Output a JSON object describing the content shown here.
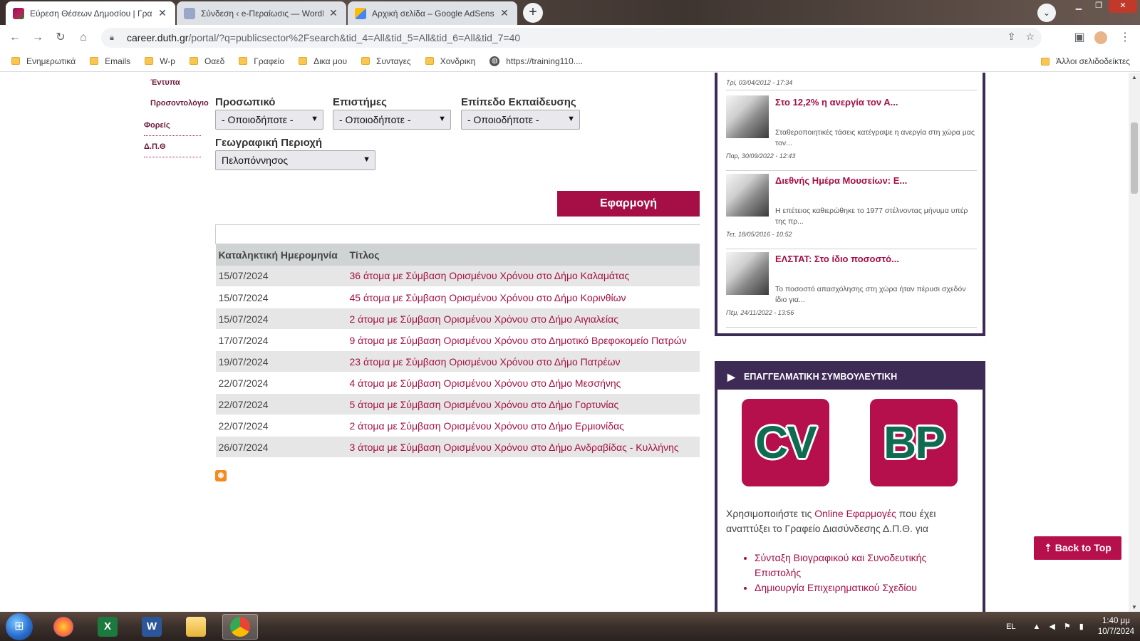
{
  "browser": {
    "tabs": [
      {
        "label": "Εύρεση Θέσεων Δημοσίου | Γραφ",
        "active": true
      },
      {
        "label": "Σύνδεση ‹ e-Περαίωσις — WordP",
        "active": false
      },
      {
        "label": "Αρχική σελίδα – Google AdSense",
        "active": false
      }
    ],
    "new_tab": "+",
    "url_host": "career.duth.gr",
    "url_path": "/portal/?q=publicsector%2Fsearch&tid_4=All&tid_5=All&tid_6=All&tid_7=40",
    "bookmarks": [
      "Ενημερωτικά",
      "Emails",
      "W-p",
      "Οαεδ",
      "Γραφείο",
      "Δικα μου",
      "Συνταγες",
      "Χονδρικη"
    ],
    "bookmark_link": "https://training110....",
    "other_bookmarks": "Άλλοι σελιδοδείκτες"
  },
  "left_nav": {
    "items": [
      "Έντυπα",
      "Προσοντολόγιο",
      "Φορείς",
      "Δ.Π.Θ"
    ]
  },
  "filters": {
    "staff_label": "Προσωπικό",
    "staff_value": "- Οποιοδήποτε -",
    "science_label": "Επιστήμες",
    "science_value": "- Οποιοδήποτε -",
    "education_label": "Επίπεδο Εκπαίδευσης",
    "education_value": "- Οποιοδήποτε -",
    "region_label": "Γεωγραφική Περιοχή",
    "region_value": "Πελοπόννησος",
    "apply_label": "Εφαρμογή"
  },
  "results": {
    "col_date": "Καταληκτική Ημερομηνία",
    "col_title": "Τίτλος",
    "rows": [
      {
        "date": "15/07/2024",
        "title": "36 άτομα με Σύμβαση Ορισμένου Χρόνου στο Δήμο Καλαμάτας"
      },
      {
        "date": "15/07/2024",
        "title": "45 άτομα με Σύμβαση Ορισμένου Χρόνου στο Δήμο Κορινθίων"
      },
      {
        "date": "15/07/2024",
        "title": "2 άτομα με Σύμβαση Ορισμένου Χρόνου στο Δήμο Αιγιαλείας"
      },
      {
        "date": "17/07/2024",
        "title": "9 άτομα με Σύμβαση Ορισμένου Χρόνου στο Δημοτικό Βρεφοκομείο Πατρών"
      },
      {
        "date": "19/07/2024",
        "title": "23 άτομα με Σύμβαση Ορισμένου Χρόνου στο Δήμο Πατρέων"
      },
      {
        "date": "22/07/2024",
        "title": "4 άτομα με Σύμβαση Ορισμένου Χρόνου στο Δήμο Μεσσήνης"
      },
      {
        "date": "22/07/2024",
        "title": "5 άτομα με Σύμβαση Ορισμένου Χρόνου στο Δήμο Γορτυνίας"
      },
      {
        "date": "22/07/2024",
        "title": "2 άτομα με Σύμβαση Ορισμένου Χρόνου στο Δήμο Ερμιονίδας"
      },
      {
        "date": "26/07/2024",
        "title": "3 άτομα με Σύμβαση Ορισμένου Χρόνου στο Δήμο Ανδραβίδας - Κυλλήνης"
      }
    ]
  },
  "news": {
    "first_date": "Τρί, 03/04/2012 - 17:34",
    "items": [
      {
        "title": "Στο 12,2% η ανεργία τον Α...",
        "excerpt": "Σταθεροποιητικές τάσεις κατέγραψε η ανεργία στη χώρα μας τον...",
        "date": "Παρ, 30/09/2022 - 12:43"
      },
      {
        "title": "Διεθνής Ημέρα Μουσείων: Ε...",
        "excerpt": "Η επέτειος καθιερώθηκε το 1977 στέλνοντας μήνυμα υπέρ της πρ...",
        "date": "Τετ, 18/05/2016 - 10:52"
      },
      {
        "title": "ΕΛΣΤΑΤ: Στο ίδιο ποσοστό...",
        "excerpt": "Το ποσοστό απασχόλησης στη χώρα ήταν πέρυσι σχεδόν ίδιο για...",
        "date": "Πέμ, 24/11/2022 - 13:56"
      }
    ]
  },
  "career": {
    "header": "ΕΠΑΓΓΕΛΜΑΤΙΚΗ ΣΥΜΒΟΥΛΕΥΤΙΚΗ",
    "cv_label": "CV",
    "bp_label": "BP",
    "text_before": "Χρησιμοποιήστε τις ",
    "text_link": "Online Εφαρμογές",
    "text_after": " που έχει αναπτύξει το Γραφείο Διασύνδεσης Δ.Π.Θ. για",
    "links": [
      "Σύνταξη Βιογραφικού και Συνοδευτικής Επιστολής",
      "Δημιουργία Επιχειρηματικού Σχεδίου"
    ]
  },
  "back_to_top": "Back to Top",
  "taskbar": {
    "lang": "EL",
    "time": "1:40 μμ",
    "date": "10/7/2024"
  },
  "colors": {
    "accent": "#a50f45",
    "sidebar_frame": "#3d2a55",
    "table_header": "#cfd3d4"
  }
}
